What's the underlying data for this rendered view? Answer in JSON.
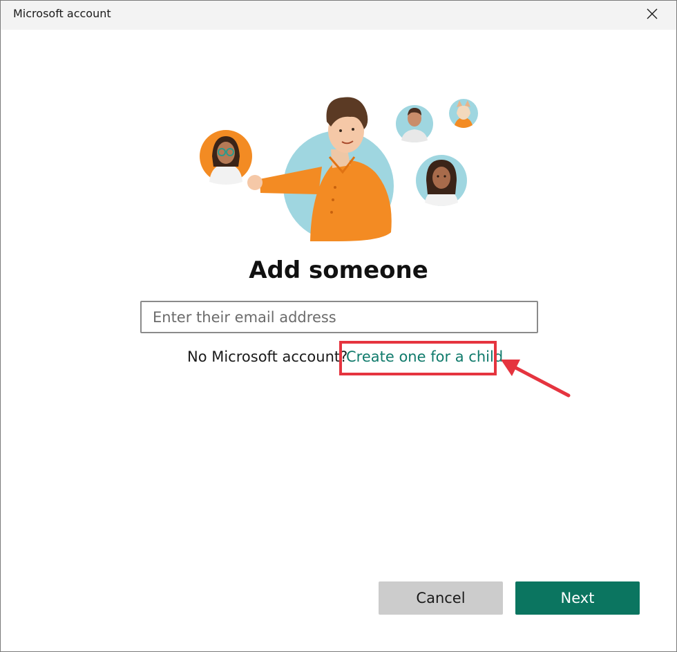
{
  "window": {
    "title": "Microsoft account",
    "close_icon": "close-icon"
  },
  "main": {
    "heading": "Add someone",
    "email_input": {
      "value": "",
      "placeholder": "Enter their email address"
    },
    "no_account_text": "No Microsoft account?",
    "create_child_link": "Create one for a child"
  },
  "buttons": {
    "cancel_label": "Cancel",
    "next_label": "Next"
  },
  "colors": {
    "link": "#0f7a6b",
    "next_button": "#0b7560",
    "cancel_button": "#cccccc",
    "annotation": "#e5343f"
  }
}
